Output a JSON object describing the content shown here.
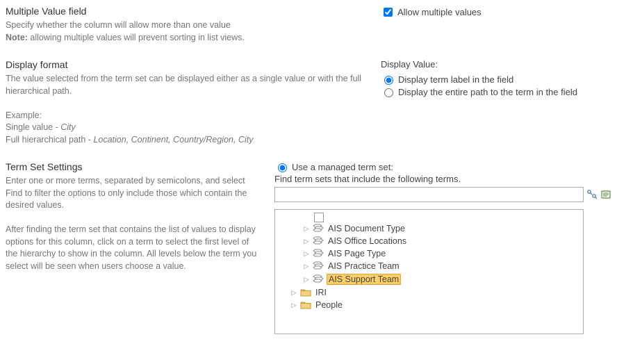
{
  "section1": {
    "heading": "Multiple Value field",
    "desc1": "Specify whether the column will allow more than one value",
    "note_label": "Note:",
    "note_text": " allowing multiple values will prevent sorting in list views.",
    "allow_label": "Allow multiple values"
  },
  "section2": {
    "heading": "Display format",
    "desc1": "The value selected from the term set can be displayed either as a single value or with the full hierarchical path.",
    "example_label": "Example:",
    "single_prefix": "Single value - ",
    "single_italic": "City",
    "full_prefix": "Full hierarchical path - ",
    "full_italic": "Location, Continent, Country/Region, City",
    "right_label": "Display Value:",
    "radio1": "Display term label in the field",
    "radio2": "Display the entire path to the term in the field"
  },
  "section3": {
    "heading": "Term Set Settings",
    "desc1": "Enter one or more terms, separated by semicolons, and select Find to filter the options to only include those which contain the desired values.",
    "desc2": "After finding the term set that contains the list of values to display options for this column, click on a term to select the first level of the hierarchy to show in the column. All levels below the term you select will be seen when users choose a value.",
    "radio1": "Use a managed term set:",
    "search_label": "Find term sets that include the following terms.",
    "search_value": ""
  },
  "tree": {
    "items": [
      {
        "label": "AIS Document Type",
        "type": "termset",
        "indent": 1,
        "selected": false
      },
      {
        "label": "AIS Office Locations",
        "type": "termset",
        "indent": 1,
        "selected": false
      },
      {
        "label": "AIS Page Type",
        "type": "termset",
        "indent": 1,
        "selected": false
      },
      {
        "label": "AIS Practice Team",
        "type": "termset",
        "indent": 1,
        "selected": false
      },
      {
        "label": "AIS Support Team",
        "type": "termset",
        "indent": 1,
        "selected": true
      },
      {
        "label": "IRI",
        "type": "folder",
        "indent": 0,
        "selected": false
      },
      {
        "label": "People",
        "type": "folder",
        "indent": 0,
        "selected": false
      }
    ]
  }
}
